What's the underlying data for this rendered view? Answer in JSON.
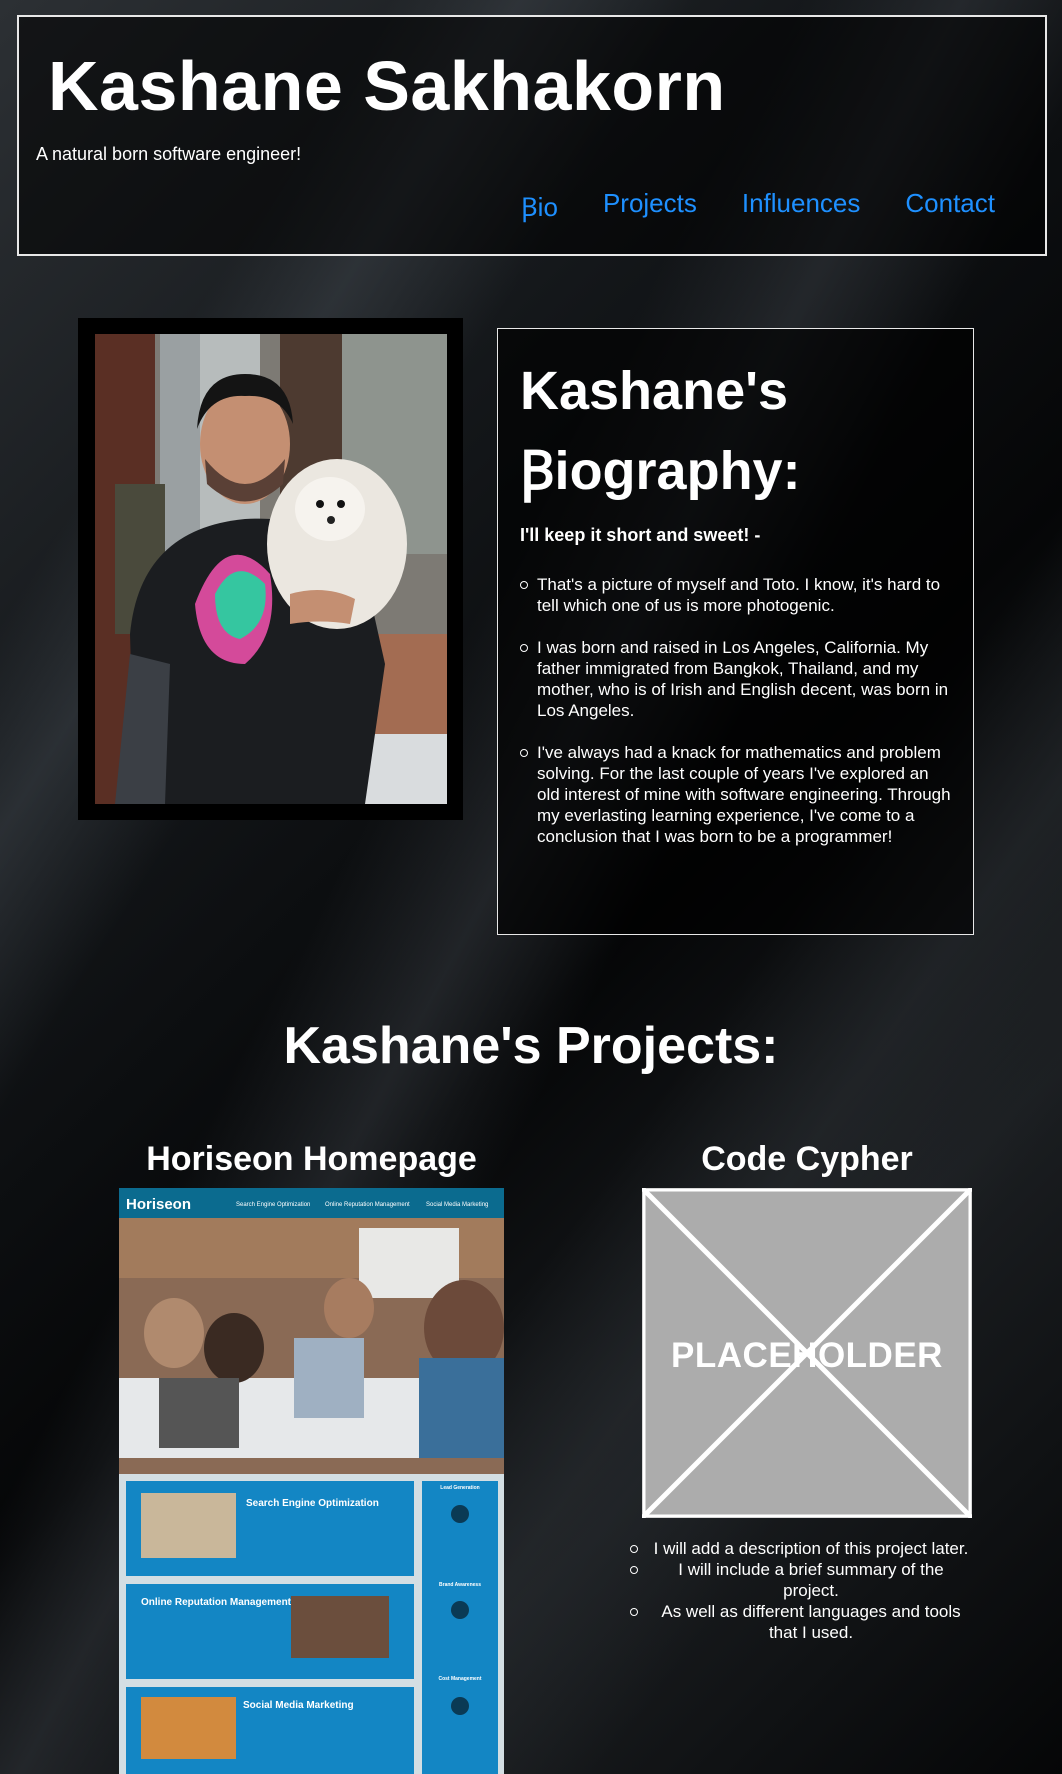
{
  "header": {
    "title": "Kashane Sakhakorn",
    "tagline": "A natural born software engineer!",
    "nav": [
      "Ꞵio",
      "Projects",
      "Influences",
      "Contact"
    ]
  },
  "bio": {
    "heading_line1": "Kashane's",
    "heading_line2": "Ꞵiography:",
    "lead": "I'll keep it short and sweet! -",
    "items": [
      "That's a picture of myself and Toto. I know, it's hard to tell which one of us is more photogenic.",
      "I was born and raised in Los Angeles, California. My father immigrated from Bangkok, Thailand, and my mother, who is of Irish and English decent, was born in Los Angeles.",
      "I've always had a knack for mathematics and problem solving. For the last couple of years I've explored an old interest of mine with software engineering. Through my everlasting learning experience, I've come to a conclusion that I was born to be a programmer!"
    ]
  },
  "projects": {
    "heading": "Kashane's Projects:",
    "cards": [
      {
        "title": "Horiseon Homepage",
        "screenshot": {
          "brand": "Horiseon",
          "nav": [
            "Search Engine Optimization",
            "Online Reputation Management",
            "Social Media Marketing"
          ],
          "sections": [
            "Search Engine Optimization",
            "Online Reputation Management",
            "Social Media Marketing"
          ],
          "sidebar": [
            "Lead Generation",
            "Brand Awareness",
            "Cost Management"
          ]
        }
      },
      {
        "title": "Code Cypher",
        "placeholder_label": "PLACEHOLDER",
        "description": [
          "I will add a description of this project later.",
          "I will include a brief summary of the project.",
          "As well as different languages and tools that I used."
        ]
      }
    ]
  },
  "colors": {
    "nav_link": "#1e90ff",
    "border": "#e8e8e8",
    "horiseon_blue": "#1386c4",
    "placeholder_gray": "#acacac"
  }
}
